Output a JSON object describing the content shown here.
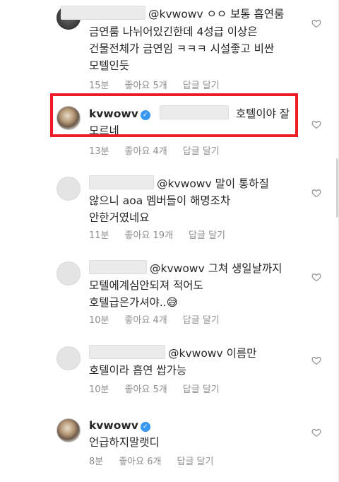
{
  "comments": [
    {
      "mention": "@kvwowv",
      "line1_rest": " ㅇㅇ 보통 흡연룸",
      "line2": "금연룸 나뉘어있긴한데 4성급 이상은",
      "line3": "건물전체가 금연임 ㅋㅋㅋ 시설좋고 비싼",
      "line4": "모텔인듯",
      "time": "15분",
      "likes": "좋아요 5개",
      "reply": "답글 달기"
    },
    {
      "username": "kvwowv",
      "line1_rest": "호텔이야 잘",
      "line2": "모르네",
      "time": "13분",
      "likes": "좋아요 4개",
      "reply": "답글 달기"
    },
    {
      "mention": "@kvwowv",
      "line1_rest": " 말이 통하질",
      "line2": "않으니 aoa 멤버들이 해명조차",
      "line3": "안한거였네요",
      "time": "11분",
      "likes": "좋아요 19개",
      "reply": "답글 달기"
    },
    {
      "mention": "@kvwowv",
      "line1_rest": " 그쳐 생일날까지",
      "line2": "모텔에계심안되져 적어도",
      "line3": "호텔급은가셔야..😅",
      "time": "10분",
      "likes": "좋아요 4개",
      "reply": "답글 달기"
    },
    {
      "mention": "@kvwowv",
      "line1_rest": " 이름만",
      "line2": "호텔이라 흡연 쌉가능",
      "time": "10분",
      "likes": "좋아요 5개",
      "reply": "답글 달기"
    },
    {
      "username": "kvwowv",
      "line2": "언급하지말랫디",
      "time": "8분",
      "likes": "좋아요 6개",
      "reply": "답글 달기"
    }
  ],
  "icons": {
    "heart": "heart-outline-icon",
    "verified": "verified-badge-icon"
  },
  "colors": {
    "highlight": "#ee1c25",
    "verified": "#3897f0",
    "meta": "#8e8e8e"
  }
}
